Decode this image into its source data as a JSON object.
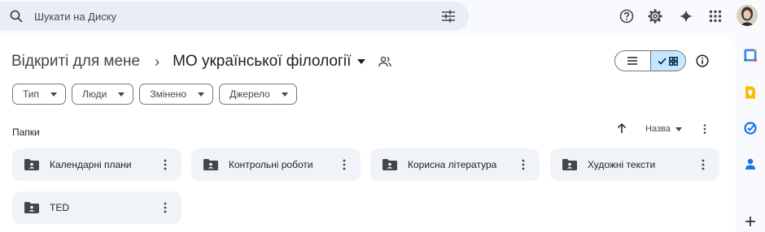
{
  "search": {
    "placeholder": "Шукати на Диску"
  },
  "header_icons": [
    "search-icon",
    "search-options-icon",
    "help-icon",
    "settings-icon",
    "gemini-icon",
    "apps-icon"
  ],
  "breadcrumb": {
    "parent": "Відкриті для мене",
    "separator": "›",
    "current": "МО української філології"
  },
  "view": {
    "mode": "grid"
  },
  "filters": [
    {
      "label": "Тип"
    },
    {
      "label": "Люди"
    },
    {
      "label": "Змінено"
    },
    {
      "label": "Джерело"
    }
  ],
  "folders_section": {
    "label": "Папки",
    "sort_label": "Назва",
    "sort_direction": "ascending"
  },
  "folders": [
    {
      "name": "Календарні плани"
    },
    {
      "name": "Контрольні роботи"
    },
    {
      "name": "Корисна література"
    },
    {
      "name": "Художні тексти"
    },
    {
      "name": "TED"
    }
  ],
  "side_panel_icons": [
    "calendar-icon",
    "keep-icon",
    "tasks-icon",
    "contacts-icon",
    "add-icon"
  ],
  "colors": {
    "background": "#f8fafd",
    "search_bg": "#e9eef6",
    "folder_bg": "#f0f4f9",
    "active_toggle": "#c2e7ff",
    "text": "#1f1f1f"
  }
}
